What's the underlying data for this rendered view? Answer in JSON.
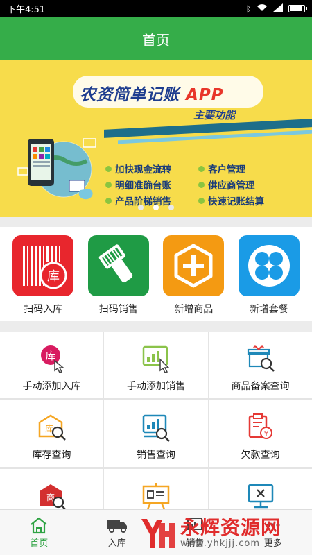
{
  "status_bar": {
    "time": "下午4:51",
    "battery_level": 0.9
  },
  "header": {
    "title": "首页"
  },
  "banner": {
    "title": "农资简单记账",
    "title_app": "APP",
    "subtitle": "主要功能",
    "features": [
      "加快现金流转",
      "客户管理",
      "明细准确台账",
      "供应商管理",
      "产品阶梯销售",
      "快速记账结算"
    ],
    "page_count": 3,
    "active_page": 2
  },
  "quick_actions": [
    {
      "label": "扫码入库",
      "icon": "barcode-stock-in-icon",
      "color": "#e8262d"
    },
    {
      "label": "扫码销售",
      "icon": "barcode-scanner-icon",
      "color": "#1f9b45"
    },
    {
      "label": "新增商品",
      "icon": "hexagon-plus-icon",
      "color": "#f49a12"
    },
    {
      "label": "新增套餐",
      "icon": "clover-icon",
      "color": "#1a9be6"
    }
  ],
  "grid_items": [
    {
      "label": "手动添加入库",
      "icon": "manual-stock-in-icon"
    },
    {
      "label": "手动添加销售",
      "icon": "manual-sales-icon"
    },
    {
      "label": "商品备案查询",
      "icon": "product-record-search-icon"
    },
    {
      "label": "库存查询",
      "icon": "inventory-search-icon"
    },
    {
      "label": "销售查询",
      "icon": "sales-search-icon"
    },
    {
      "label": "欠款查询",
      "icon": "debt-search-icon"
    },
    {
      "label": "",
      "icon": "store-search-icon"
    },
    {
      "label": "",
      "icon": "presentation-board-icon"
    },
    {
      "label": "",
      "icon": "monitor-close-icon"
    }
  ],
  "bottom_nav": [
    {
      "label": "首页",
      "icon": "home-icon",
      "active": true
    },
    {
      "label": "入库",
      "icon": "truck-icon",
      "active": false
    },
    {
      "label": "销售",
      "icon": "sales-icon",
      "active": false
    },
    {
      "label": "更多",
      "icon": "more-icon",
      "active": false
    }
  ],
  "watermark": {
    "text": "永辉资源网",
    "url": "www.yhkjjj.com"
  },
  "colors": {
    "primary_green": "#35ad49",
    "banner_yellow": "#f7dc4b",
    "nav_active": "#2ea343"
  }
}
